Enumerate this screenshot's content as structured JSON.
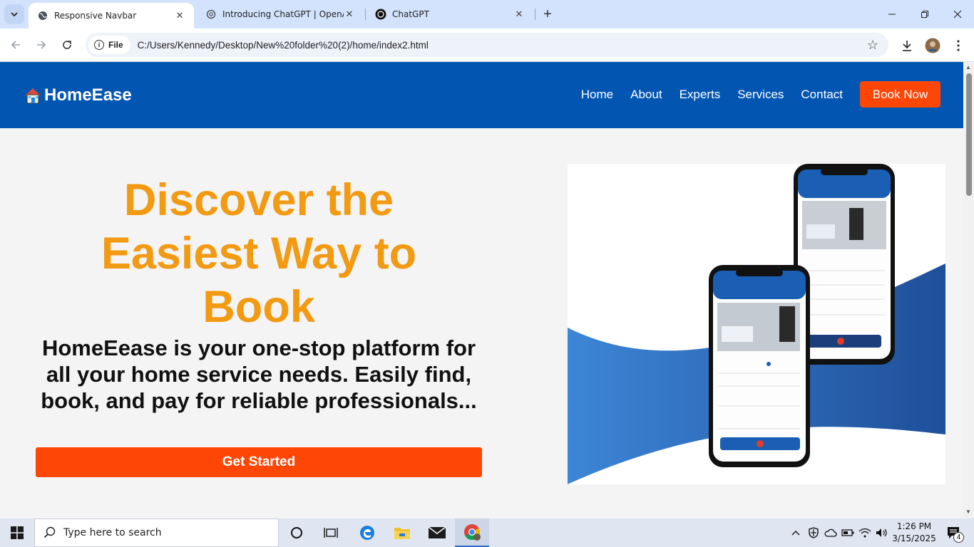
{
  "browser": {
    "tabs": [
      {
        "title": "Responsive Navbar",
        "active": true
      },
      {
        "title": "Introducing ChatGPT | OpenAI",
        "active": false
      },
      {
        "title": "ChatGPT",
        "active": false
      }
    ],
    "address": {
      "scheme_chip": "File",
      "url": "C:/Users/Kennedy/Desktop/New%20folder%20(2)/home/index2.html"
    }
  },
  "site": {
    "logo_text": "HomeEase",
    "nav": [
      "Home",
      "About",
      "Experts",
      "Services",
      "Contact"
    ],
    "book_label": "Book Now",
    "hero": {
      "title": "Discover the Easiest Way to Book",
      "description": "HomeEease is your one-stop platform for all your home service needs. Easily find, book, and pay for reliable professionals...",
      "cta_label": "Get Started"
    },
    "colors": {
      "nav_bg": "#0256b2",
      "accent": "#fe4606",
      "title": "#f29a12"
    }
  },
  "taskbar": {
    "search_placeholder": "Type here to search",
    "time": "1:26 PM",
    "date": "3/15/2025",
    "notification_count": "4"
  }
}
